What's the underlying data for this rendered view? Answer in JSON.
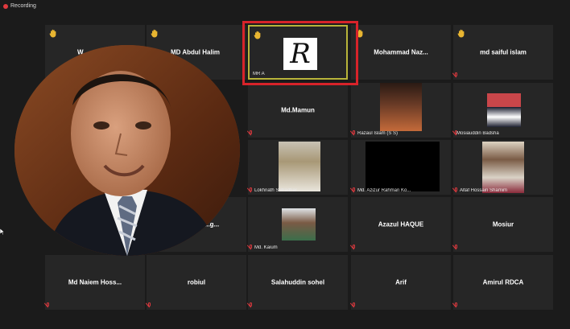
{
  "recording": {
    "label": "Recording",
    "dot_color": "#e0393e"
  },
  "tiles": [
    {
      "name": "W...",
      "label": ""
    },
    {
      "name": "MD Abdul Halim",
      "label": ""
    },
    {
      "name": "",
      "label": "MR A",
      "logo_letter": "R"
    },
    {
      "name": "Mohammad  Naz...",
      "label": ""
    },
    {
      "name": "md saiful islam",
      "label": ""
    },
    {
      "name": "Md.Mamun",
      "label": ""
    },
    {
      "name": "",
      "label": "Razaul Islam (S S)"
    },
    {
      "name": "",
      "label": "Mosiauddin Badsha"
    },
    {
      "name": "",
      "label": "Lokhnath Sutradhar"
    },
    {
      "name": "",
      "label": "Md. Azizur Rahman Ko..."
    },
    {
      "name": "",
      "label": "Altaf Hossain Shamim"
    },
    {
      "name": "...g...",
      "label": ""
    },
    {
      "name": "",
      "label": "Md. Kaium"
    },
    {
      "name": "Azazul  HAQUE",
      "label": ""
    },
    {
      "name": "Mosiur",
      "label": ""
    },
    {
      "name": "Md  Naiem  Hoss...",
      "label": ""
    },
    {
      "name": "robiul",
      "label": ""
    },
    {
      "name": "Salahuddin sohel",
      "label": ""
    },
    {
      "name": "Arif",
      "label": ""
    },
    {
      "name": "Amirul  RDCA",
      "label": ""
    }
  ],
  "colors": {
    "background": "#1b1b1b",
    "tile": "#262626",
    "hand": "#e8b531",
    "mute": "#e0393e",
    "highlight": "#d8232a",
    "active_speaker": "#b8b43a"
  },
  "icons": {
    "raised_hand": "raised-hand-icon",
    "muted_mic": "muted-mic-icon",
    "recording": "recording-dot-icon",
    "cursor": "mouse-cursor-icon"
  }
}
